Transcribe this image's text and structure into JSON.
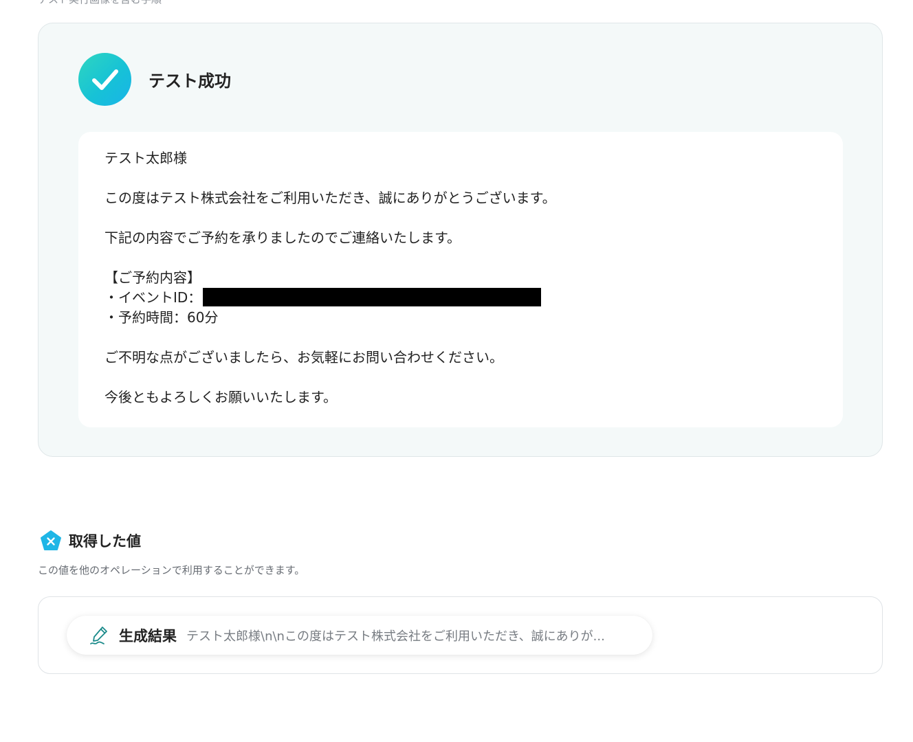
{
  "header_cut_text": "テスト実行画像を含む手順",
  "test_result": {
    "title": "テスト成功",
    "icon": "check-circle-icon",
    "message": {
      "greeting": "テスト太郎様",
      "thanks": "この度はテスト株式会社をご利用いただき、誠にありがとうございます。",
      "notice": "下記の内容でご予約を承りましたのでご連絡いたします。",
      "section_heading": "【ご予約内容】",
      "event_id_label": "・イベントID：",
      "duration_line": "・予約時間：60分",
      "inquiry": "ご不明な点がございましたら、お気軽にお問い合わせください。",
      "closing": "今後ともよろしくお願いいたします。"
    }
  },
  "acquired_values": {
    "title": "取得した値",
    "icon": "variable-pentagon-icon",
    "description": "この値を他のオペレーションで利用することができます。",
    "items": [
      {
        "icon": "pen-icon",
        "label": "生成結果",
        "value": "テスト太郎様\\n\\nこの度はテスト株式会社をご利用いただき、誠にありが..."
      }
    ]
  },
  "colors": {
    "success_gradient_start": "#2fd6c0",
    "success_gradient_end": "#18b4e8",
    "panel_background": "#f4f9f9",
    "variable_icon": "#1fb6e6",
    "pen_icon": "#1a8a8a"
  }
}
